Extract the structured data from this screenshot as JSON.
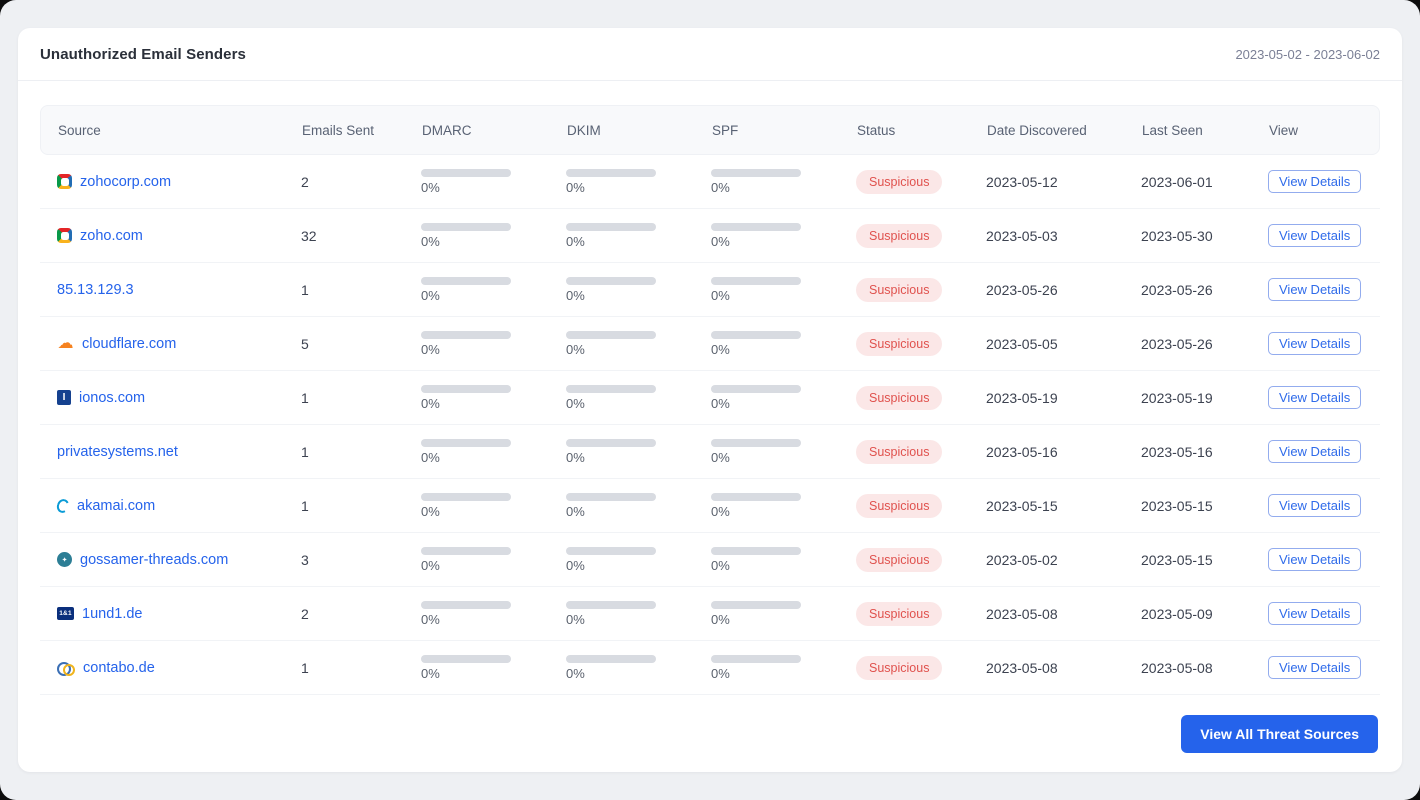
{
  "panel": {
    "title": "Unauthorized Email Senders",
    "date_range": "2023-05-02 - 2023-06-02",
    "footer_button_label": "View All Threat Sources"
  },
  "table": {
    "columns": [
      "Source",
      "Emails Sent",
      "DMARC",
      "DKIM",
      "SPF",
      "Status",
      "Date Discovered",
      "Last Seen",
      "View"
    ],
    "view_button_label": "View Details",
    "rows": [
      {
        "source": "zohocorp.com",
        "icon": "zoho",
        "emails_sent": "2",
        "dmarc": "0%",
        "dkim": "0%",
        "spf": "0%",
        "status": "Suspicious",
        "date_discovered": "2023-05-12",
        "last_seen": "2023-06-01"
      },
      {
        "source": "zoho.com",
        "icon": "zoho",
        "emails_sent": "32",
        "dmarc": "0%",
        "dkim": "0%",
        "spf": "0%",
        "status": "Suspicious",
        "date_discovered": "2023-05-03",
        "last_seen": "2023-05-30"
      },
      {
        "source": "85.13.129.3",
        "icon": "none",
        "emails_sent": "1",
        "dmarc": "0%",
        "dkim": "0%",
        "spf": "0%",
        "status": "Suspicious",
        "date_discovered": "2023-05-26",
        "last_seen": "2023-05-26"
      },
      {
        "source": "cloudflare.com",
        "icon": "cloudflare",
        "emails_sent": "5",
        "dmarc": "0%",
        "dkim": "0%",
        "spf": "0%",
        "status": "Suspicious",
        "date_discovered": "2023-05-05",
        "last_seen": "2023-05-26"
      },
      {
        "source": "ionos.com",
        "icon": "ionos",
        "emails_sent": "1",
        "dmarc": "0%",
        "dkim": "0%",
        "spf": "0%",
        "status": "Suspicious",
        "date_discovered": "2023-05-19",
        "last_seen": "2023-05-19"
      },
      {
        "source": "privatesystems.net",
        "icon": "none",
        "emails_sent": "1",
        "dmarc": "0%",
        "dkim": "0%",
        "spf": "0%",
        "status": "Suspicious",
        "date_discovered": "2023-05-16",
        "last_seen": "2023-05-16"
      },
      {
        "source": "akamai.com",
        "icon": "akamai",
        "emails_sent": "1",
        "dmarc": "0%",
        "dkim": "0%",
        "spf": "0%",
        "status": "Suspicious",
        "date_discovered": "2023-05-15",
        "last_seen": "2023-05-15"
      },
      {
        "source": "gossamer-threads.com",
        "icon": "gossamer-threads",
        "emails_sent": "3",
        "dmarc": "0%",
        "dkim": "0%",
        "spf": "0%",
        "status": "Suspicious",
        "date_discovered": "2023-05-02",
        "last_seen": "2023-05-15"
      },
      {
        "source": "1und1.de",
        "icon": "1und1",
        "emails_sent": "2",
        "dmarc": "0%",
        "dkim": "0%",
        "spf": "0%",
        "status": "Suspicious",
        "date_discovered": "2023-05-08",
        "last_seen": "2023-05-09"
      },
      {
        "source": "contabo.de",
        "icon": "contabo",
        "emails_sent": "1",
        "dmarc": "0%",
        "dkim": "0%",
        "spf": "0%",
        "status": "Suspicious",
        "date_discovered": "2023-05-08",
        "last_seen": "2023-05-08"
      }
    ],
    "colors": {
      "accent_blue": "#2563eb",
      "link_blue": "#2563eb",
      "status_text": "#e0524e",
      "status_bg": "#fbe7e7",
      "progress_bar": "#d8dbe1"
    },
    "progress_values": {
      "dmarc": 0,
      "dkim": 0,
      "spf": 0
    }
  }
}
